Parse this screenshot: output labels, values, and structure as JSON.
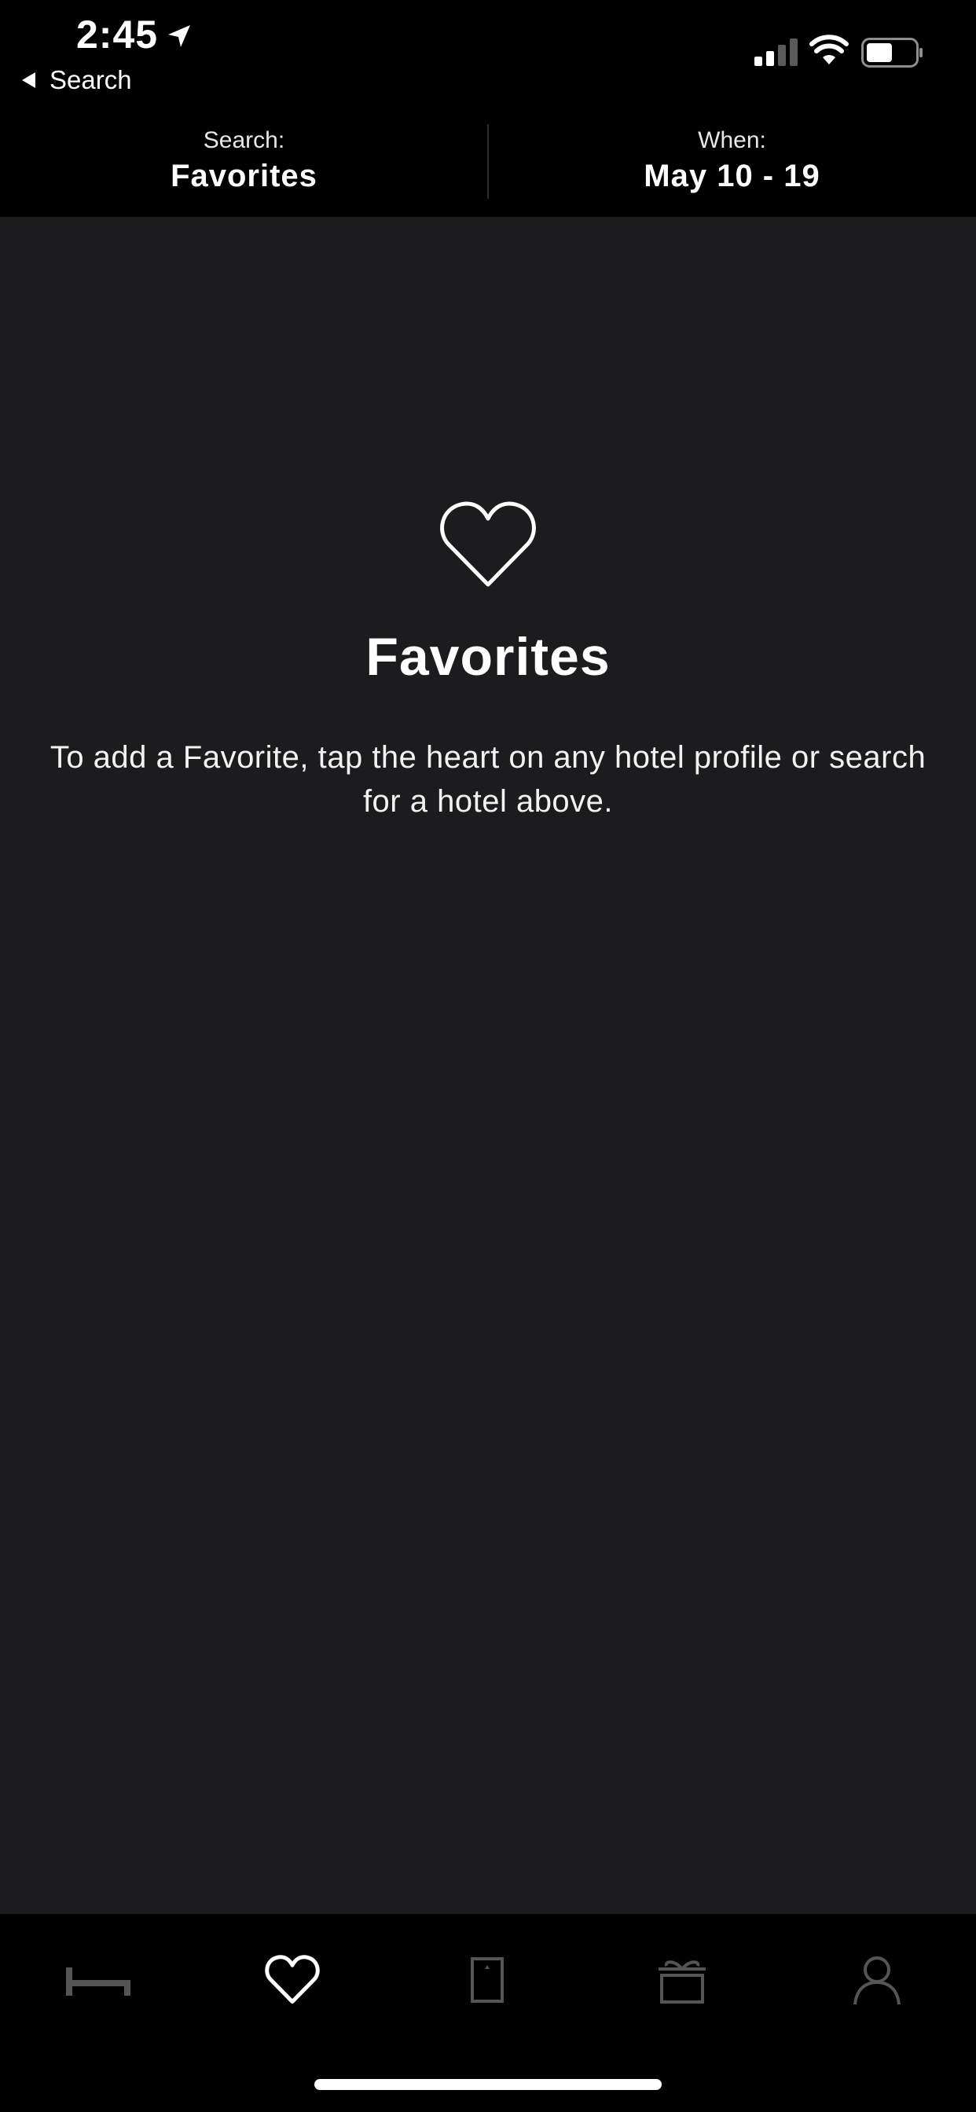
{
  "status_bar": {
    "time": "2:45",
    "back_label": "Search"
  },
  "search_header": {
    "search_label": "Search:",
    "search_value": "Favorites",
    "when_label": "When:",
    "when_value": "May 10 - 19"
  },
  "empty_state": {
    "icon": "heart-icon",
    "title": "Favorites",
    "message": "To add a Favorite, tap the heart on any hotel profile or search for a hotel above."
  },
  "tab_bar": {
    "items": [
      {
        "icon": "bed-icon",
        "selected": false
      },
      {
        "icon": "heart-icon",
        "selected": true
      },
      {
        "icon": "door-icon",
        "selected": false
      },
      {
        "icon": "gift-icon",
        "selected": false
      },
      {
        "icon": "person-icon",
        "selected": false
      }
    ]
  },
  "colors": {
    "background": "#000000",
    "content_background": "#1c1c1e",
    "text": "#ffffff",
    "inactive_icon": "#555555"
  }
}
